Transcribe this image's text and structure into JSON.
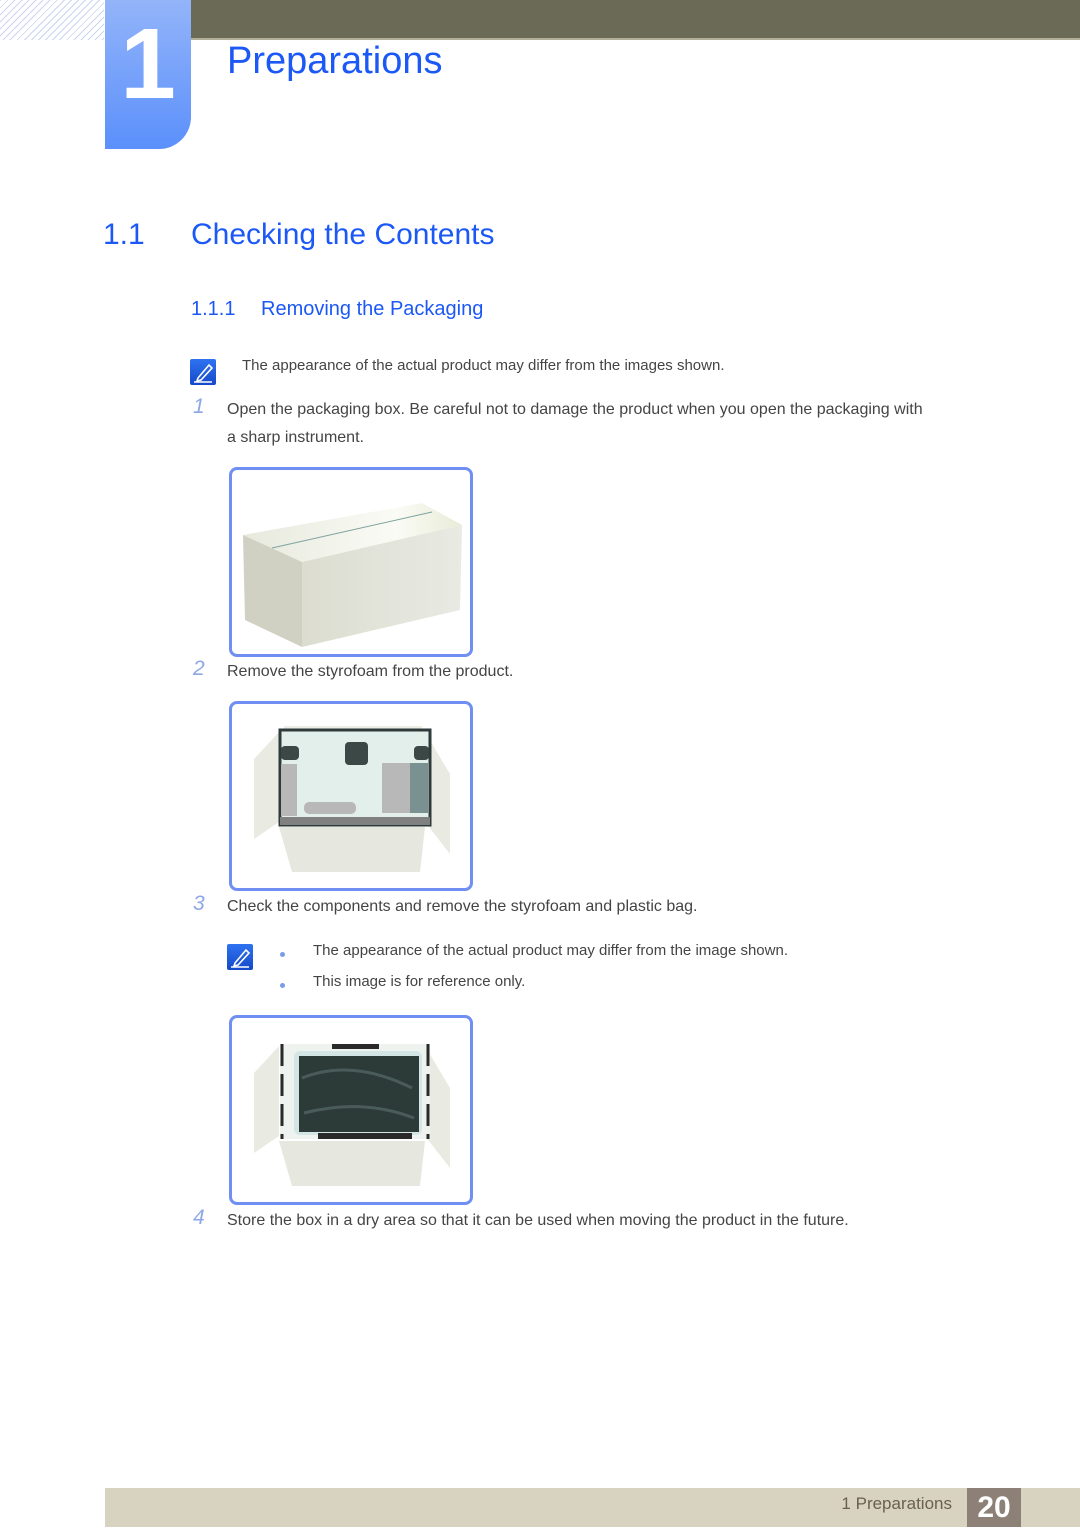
{
  "header": {
    "chapter_number": "1",
    "chapter_title": "Preparations"
  },
  "section": {
    "number": "1.1",
    "title": "Checking the Contents"
  },
  "subsection": {
    "number": "1.1.1",
    "title": "Removing the Packaging"
  },
  "intro_note": {
    "icon": "note-pencil-icon",
    "text": "The appearance of the actual product may differ from the images shown."
  },
  "steps": [
    {
      "number": "1",
      "text_line1": "Open the packaging box. Be careful not to damage the product when you open the packaging with",
      "text_line2": "a sharp instrument.",
      "figure": "closed-box"
    },
    {
      "number": "2",
      "text": "Remove the styrofoam from the product.",
      "figure": "open-box-styrofoam"
    },
    {
      "number": "3",
      "text": "Check the components and remove the styrofoam and plastic bag.",
      "figure": "open-box-monitor-bag",
      "notes": [
        "The appearance of the actual product may differ from the image shown.",
        "This image is for reference only."
      ]
    },
    {
      "number": "4",
      "text": "Store the box in a dry area so that it can be used when moving the product in the future."
    }
  ],
  "footer": {
    "chapter_label": "1 Preparations",
    "page_number": "20"
  },
  "colors": {
    "accent_blue": "#1b58f6",
    "top_bar": "#6b6a57",
    "footer_band": "#d8d2c0",
    "page_box": "#8d8177"
  }
}
